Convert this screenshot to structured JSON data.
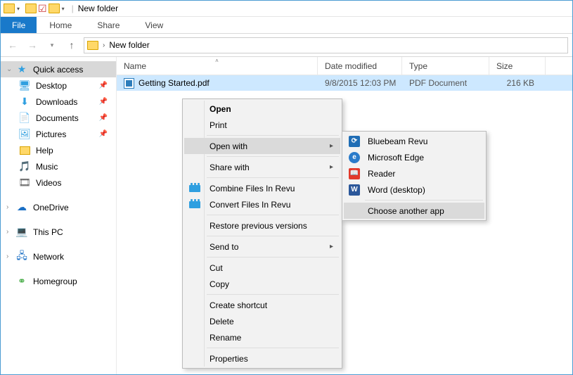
{
  "window": {
    "title": "New folder"
  },
  "ribbon": {
    "file": "File",
    "home": "Home",
    "share": "Share",
    "view": "View"
  },
  "address": {
    "location": "New folder"
  },
  "sidebar": {
    "quick": "Quick access",
    "desktop": "Desktop",
    "downloads": "Downloads",
    "documents": "Documents",
    "pictures": "Pictures",
    "help": "Help",
    "music": "Music",
    "videos": "Videos",
    "onedrive": "OneDrive",
    "thispc": "This PC",
    "network": "Network",
    "homegroup": "Homegroup"
  },
  "columns": {
    "name": "Name",
    "date": "Date modified",
    "type": "Type",
    "size": "Size"
  },
  "file": {
    "name": "Getting Started.pdf",
    "date": "9/8/2015 12:03 PM",
    "type": "PDF Document",
    "size": "216 KB"
  },
  "menu": {
    "open": "Open",
    "print": "Print",
    "openwith": "Open with",
    "sharewith": "Share with",
    "combine": "Combine Files In Revu",
    "convert": "Convert Files In Revu",
    "restore": "Restore previous versions",
    "sendto": "Send to",
    "cut": "Cut",
    "copy": "Copy",
    "shortcut": "Create shortcut",
    "delete": "Delete",
    "rename": "Rename",
    "properties": "Properties"
  },
  "submenu": {
    "bluebeam": "Bluebeam Revu",
    "edge": "Microsoft Edge",
    "reader": "Reader",
    "word": "Word (desktop)",
    "choose": "Choose another app"
  }
}
